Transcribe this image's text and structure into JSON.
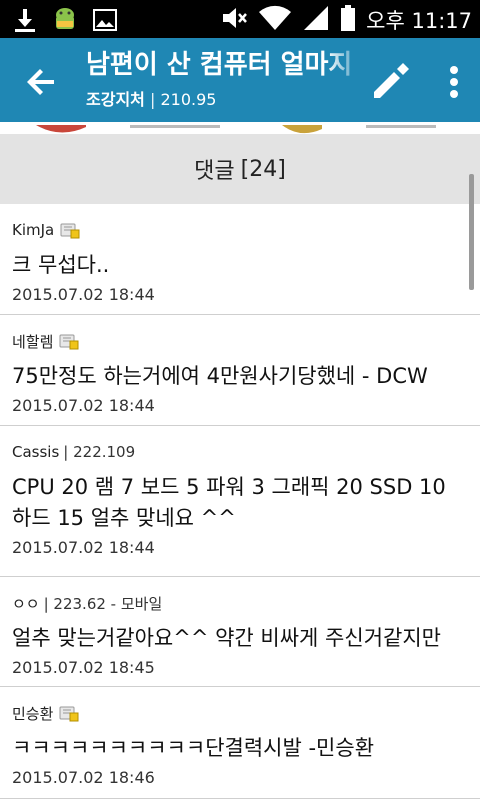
{
  "status_bar": {
    "time": "오후 11:17",
    "icons": [
      "download-icon",
      "android-icon",
      "image-icon",
      "mute-icon",
      "wifi-icon",
      "signal-icon",
      "battery-icon"
    ]
  },
  "app_bar": {
    "title": "남편이 산 컴퓨터 얼마지",
    "board": "조강지처",
    "separator": "|",
    "views": "210.95",
    "color": "#1f87b4"
  },
  "comments_header": {
    "label": "댓글",
    "count": "[24]"
  },
  "comments": [
    {
      "author": "KimJa",
      "info": "",
      "body": "크 무섭다..",
      "date": "2015.07.02 18:44",
      "badge": "lock-icon"
    },
    {
      "author": "네할렘",
      "info": "",
      "body": "75만정도 하는거에여 4만원사기당했네 - DCW",
      "date": "2015.07.02 18:44",
      "badge": "lock-icon"
    },
    {
      "author": "Cassis",
      "info": "| 222.109",
      "body": "CPU 20 램 7 보드 5 파워 3 그래픽 20 SSD 10 하드 15 얼추 맞네요 ^^",
      "date": "2015.07.02 18:44",
      "badge": ""
    },
    {
      "author": "ㅇㅇ",
      "info": "| 223.62 - 모바일",
      "body": "얼추 맞는거같아요^^ 약간 비싸게 주신거같지만",
      "date": "2015.07.02 18:45",
      "badge": ""
    },
    {
      "author": "민승환",
      "info": "",
      "body": "ㅋㅋㅋㅋㅋㅋㅋㅋㅋㅋ단결력시발 -민승환",
      "date": "2015.07.02 18:46",
      "badge": "lock-icon"
    }
  ]
}
